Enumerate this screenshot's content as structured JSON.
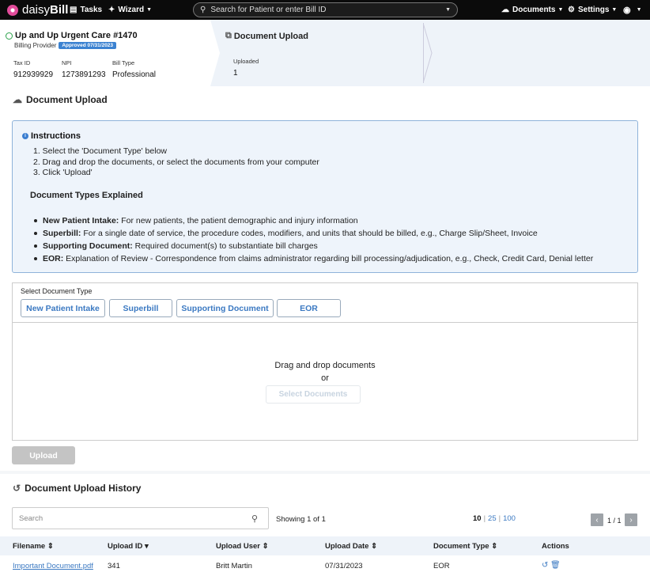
{
  "nav": {
    "brand_a": "daisy",
    "brand_b": "Bill",
    "tasks": "Tasks",
    "wizard": "Wizard",
    "search_placeholder": "Search for Patient or enter Bill ID",
    "documents": "Documents",
    "settings": "Settings"
  },
  "provider": {
    "name": "Up and Up Urgent Care #1470",
    "role": "Billing Provider",
    "badge": "Approved 07/31/2023",
    "tax_id_label": "Tax ID",
    "tax_id": "912939929",
    "npi_label": "NPI",
    "npi": "1273891293",
    "bill_type_label": "Bill Type",
    "bill_type": "Professional"
  },
  "upload_card": {
    "title": "Document Upload",
    "uploaded_label": "Uploaded",
    "uploaded": "1"
  },
  "page_title": "Document Upload",
  "instructions": {
    "title": "Instructions",
    "steps": [
      "1. Select the 'Document Type' below",
      "2. Drag and drop the documents, or select the documents from your computer",
      "3. Click 'Upload'"
    ],
    "types_heading": "Document Types Explained",
    "types": [
      {
        "term": "New Patient Intake:",
        "desc": " For new patients, the patient demographic and injury information"
      },
      {
        "term": "Superbill:",
        "desc": " For a single date of service, the procedure codes, modifiers, and units that should be billed, e.g., Charge Slip/Sheet, Invoice"
      },
      {
        "term": "Supporting Document:",
        "desc": " Required document(s) to substantiate bill charges"
      },
      {
        "term": "EOR:",
        "desc": " Explanation of Review - Correspondence from claims administrator regarding bill processing/adjudication, e.g., Check, Credit Card, Denial letter"
      }
    ]
  },
  "doc_type": {
    "label": "Select Document Type",
    "buttons": [
      "New Patient Intake",
      "Superbill",
      "Supporting Document",
      "EOR"
    ],
    "drop_text": "Drag and drop documents",
    "or": "or",
    "select_button": "Select Documents",
    "upload_button": "Upload"
  },
  "history": {
    "title": "Document Upload History",
    "search_placeholder": "Search",
    "showing": "Showing 1 of 1",
    "page_sizes": [
      "10",
      "25",
      "100"
    ],
    "page_count": "1 / 1",
    "columns": [
      "Filename",
      "Upload ID",
      "Upload User",
      "Upload Date",
      "Document Type",
      "Actions"
    ],
    "rows": [
      {
        "filename": "Important Document.pdf",
        "upload_id": "341",
        "user": "Britt Martin",
        "date": "07/31/2023",
        "type": "EOR"
      }
    ]
  }
}
